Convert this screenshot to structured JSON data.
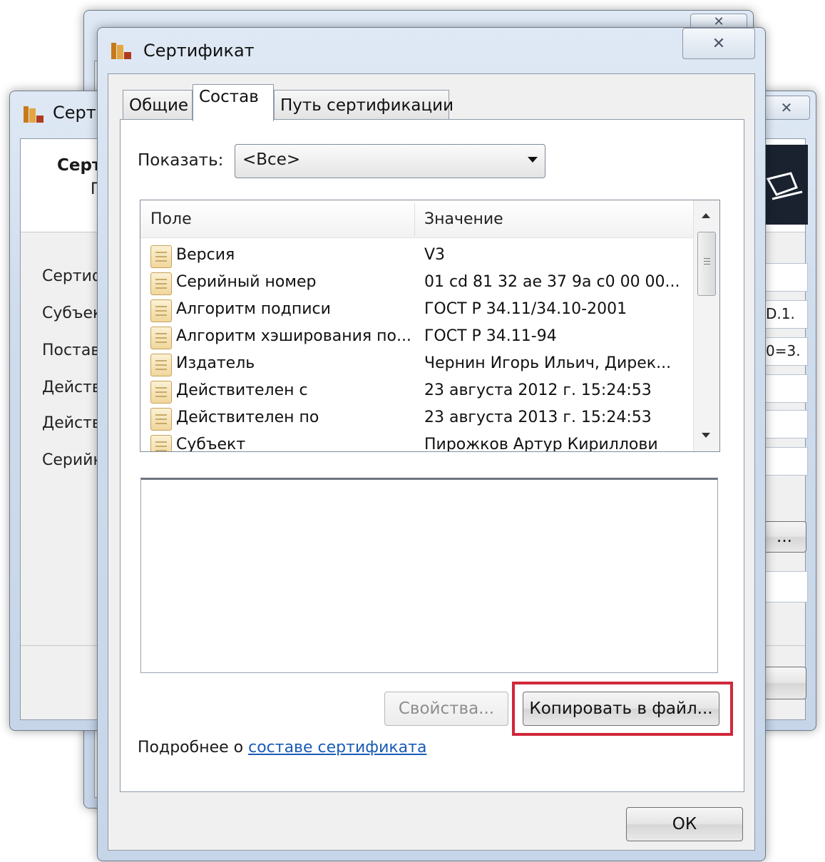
{
  "back_dialog": {
    "title": "Серт",
    "heading": "Серт",
    "subheading": "Г",
    "field_labels": [
      "Сертиф",
      "Субъек",
      "Постав",
      "Действ",
      "Действ",
      "Серийн"
    ],
    "field_values": [
      "",
      "D.1.",
      "0=3.",
      "",
      "",
      ""
    ],
    "browse_label": "..."
  },
  "dialog": {
    "title": "Сертификат",
    "tabs": [
      {
        "label": "Общие",
        "active": false
      },
      {
        "label": "Состав",
        "active": true
      },
      {
        "label": "Путь сертификации",
        "active": false
      }
    ],
    "show_label": "Показать:",
    "show_value": "<Все>",
    "columns": {
      "field": "Поле",
      "value": "Значение"
    },
    "rows": [
      {
        "field": "Версия",
        "value": "V3"
      },
      {
        "field": "Серийный номер",
        "value": "01 cd 81 32 ae 37 9a c0 00 00..."
      },
      {
        "field": "Алгоритм подписи",
        "value": "ГОСТ Р 34.11/34.10-2001"
      },
      {
        "field": "Алгоритм хэширования по...",
        "value": "ГОСТ Р 34.11-94"
      },
      {
        "field": "Издатель",
        "value": "Чернин Игорь Ильич, Дирек..."
      },
      {
        "field": "Действителен с",
        "value": "23 августа 2012 г. 15:24:53"
      },
      {
        "field": "Действителен по",
        "value": "23 августа 2013 г. 15:24:53"
      },
      {
        "field": "Субъект",
        "value": "Пирожков Артур Кириллови"
      }
    ],
    "properties_button": "Свойства...",
    "copy_button": "Копировать в файл...",
    "more_info_prefix": "Подробнее о ",
    "more_info_link": "составе сертификата",
    "ok_button": "ОК"
  },
  "colors": {
    "highlight": "#d0273a",
    "link": "#1a5bb5",
    "titlebar": "#cfdcec"
  },
  "icons": [
    "certificate-app-icon",
    "close-icon",
    "certificate-field-icon",
    "chevron-down-icon",
    "scroll-up-icon",
    "scroll-down-icon"
  ]
}
